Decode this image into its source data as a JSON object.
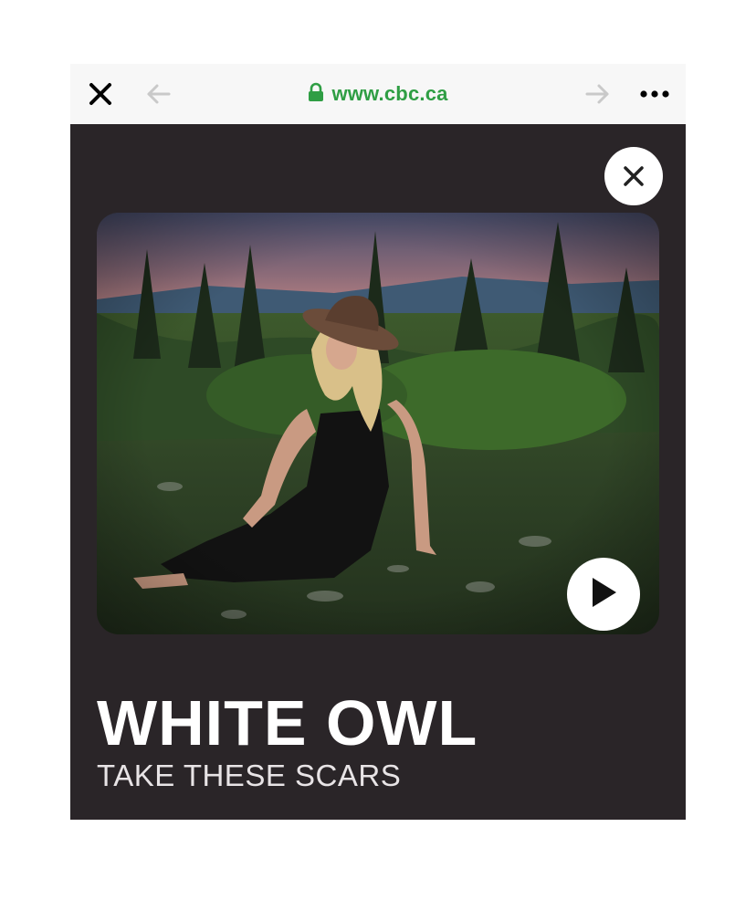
{
  "browser": {
    "url": "www.cbc.ca",
    "url_color": "#2f9e44",
    "icons": [
      "close-icon",
      "back-arrow-icon",
      "lock-icon",
      "forward-arrow-icon",
      "more-icon"
    ]
  },
  "card": {
    "background": "#2a2528",
    "title": "WHITE OWL",
    "subtitle": "TAKE THESE SCARS",
    "close_icon": "close-icon",
    "play_icon": "play-icon"
  }
}
